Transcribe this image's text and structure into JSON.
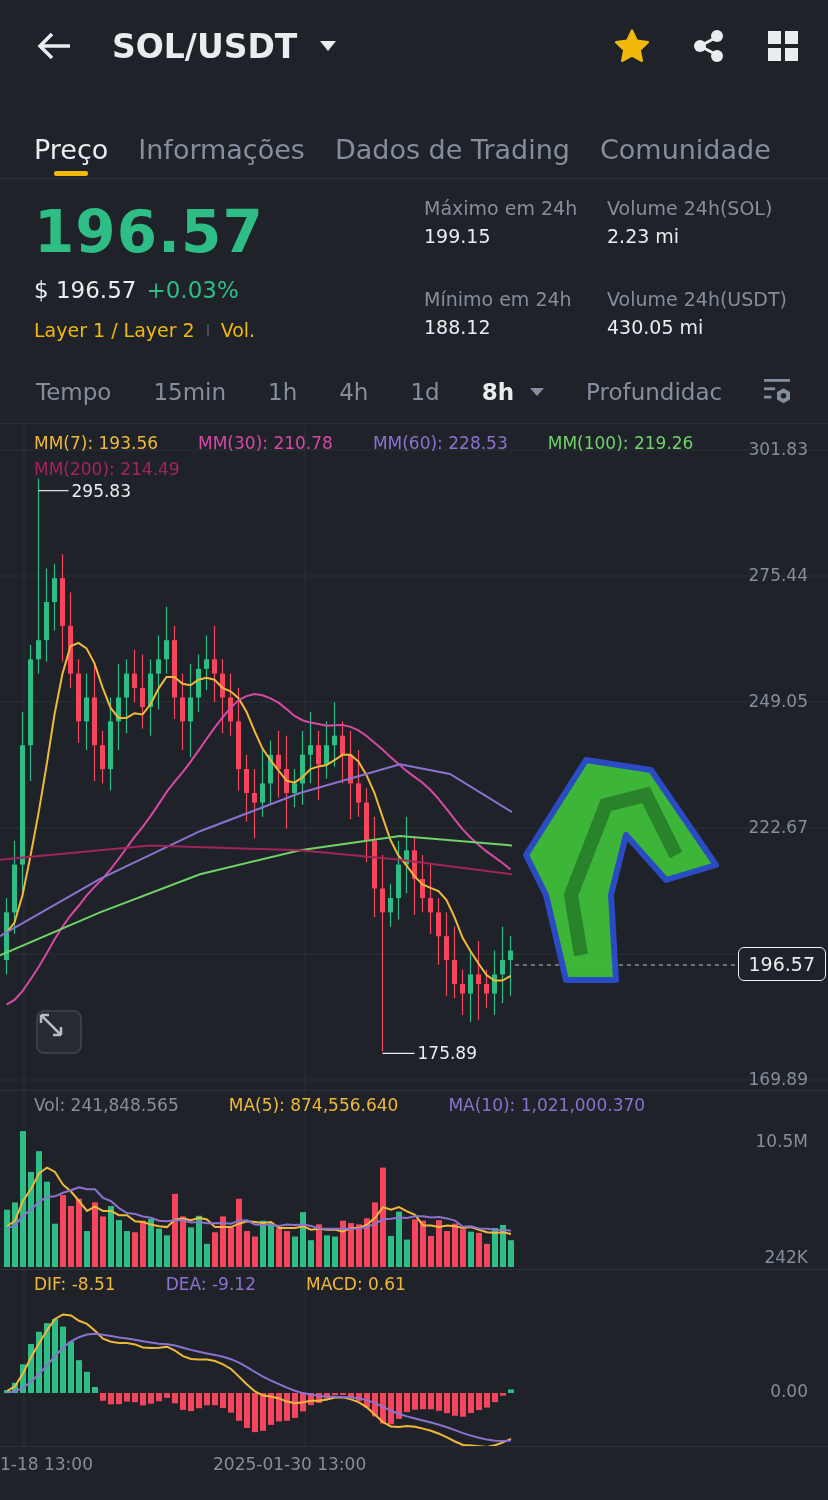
{
  "header": {
    "title": "SOL/USDT",
    "favorite": true
  },
  "tabs": [
    {
      "label": "Preço",
      "selected": true
    },
    {
      "label": "Informações",
      "selected": false
    },
    {
      "label": "Dados de Trading",
      "selected": false
    },
    {
      "label": "Comunidade",
      "selected": false
    }
  ],
  "price": {
    "last": "196.57",
    "usd": "$ 196.57",
    "change": "+0.03%",
    "tags": [
      "Layer 1 / Layer 2",
      "Vol."
    ]
  },
  "stats": [
    {
      "label": "Máximo em 24h",
      "value": "199.15"
    },
    {
      "label": "Volume 24h(SOL)",
      "value": "2.23 mi"
    },
    {
      "label": "Mínimo em 24h",
      "value": "188.12"
    },
    {
      "label": "Volume 24h(USDT)",
      "value": "430.05 mi"
    }
  ],
  "intervals": [
    {
      "label": "Tempo",
      "kind": "plain",
      "selected": false
    },
    {
      "label": "15min",
      "kind": "plain",
      "selected": false
    },
    {
      "label": "1h",
      "kind": "plain",
      "selected": false
    },
    {
      "label": "4h",
      "kind": "plain",
      "selected": false
    },
    {
      "label": "1d",
      "kind": "plain",
      "selected": false
    },
    {
      "label": "8h",
      "kind": "dropdown",
      "selected": true
    },
    {
      "label": "Profundidac",
      "kind": "plain",
      "selected": false
    }
  ],
  "chart": {
    "legend": [
      {
        "label": "MM(7): 193.56",
        "color": "#f0b93a"
      },
      {
        "label": "MM(30): 210.78",
        "color": "#d64aa6"
      },
      {
        "label": "MM(60): 228.53",
        "color": "#8c72d0"
      },
      {
        "label": "MM(100): 219.26",
        "color": "#6fd36a"
      },
      {
        "label": "MM(200): 214.49",
        "color": "#a3245c"
      }
    ],
    "price_ticks": [
      "301.83",
      "275.44",
      "249.05",
      "222.67",
      "169.89"
    ],
    "high_label": "295.83",
    "low_label": "175.89",
    "current_price": "196.57"
  },
  "volume": {
    "legend": [
      {
        "label": "Vol: 241,848.565",
        "color": "#8a8f98"
      },
      {
        "label": "MA(5): 874,556.640",
        "color": "#f0b93a"
      },
      {
        "label": "MA(10): 1,021,000.370",
        "color": "#8c72d0"
      }
    ],
    "ticks": [
      "10.5M",
      "242K"
    ]
  },
  "macd": {
    "legend": [
      {
        "label": "DIF: -8.51",
        "color": "#f0b93a"
      },
      {
        "label": "DEA: -9.12",
        "color": "#8c72d0"
      },
      {
        "label": "MACD: 0.61",
        "color": "#f0b93a"
      }
    ],
    "ticks": [
      "0.00"
    ]
  },
  "dates": [
    "1-18 13:00",
    "2025-01-30 13:00"
  ]
}
